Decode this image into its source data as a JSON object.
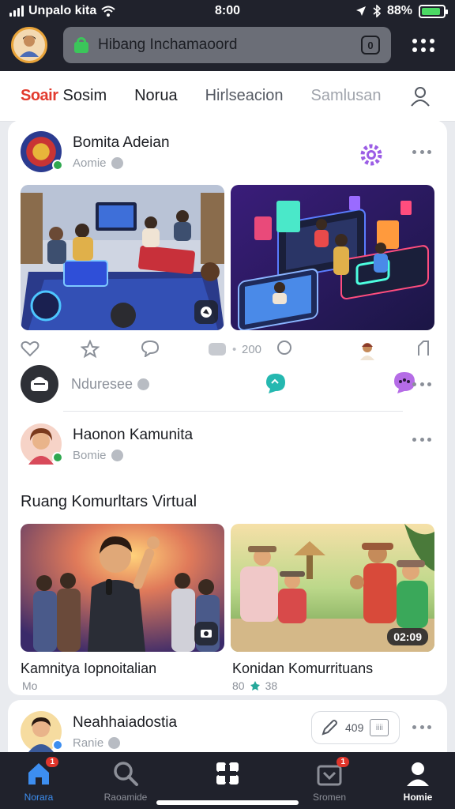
{
  "status_bar": {
    "carrier": "Unpalo kita",
    "time": "8:00",
    "battery": "88%",
    "battery_level": 0.88
  },
  "header": {
    "url_text": "Hibang  Inchamaoord",
    "tab_count": "0"
  },
  "tabs": [
    {
      "label": "Soair",
      "style": "logo"
    },
    {
      "label": "Sosim"
    },
    {
      "label": "Norua"
    },
    {
      "label": "Hirlseacion"
    },
    {
      "label": "Samlusan"
    }
  ],
  "post1": {
    "author": "Bomita Adeian",
    "sub": "Aomie",
    "engagement_count": "200",
    "reply_label": "Nduresee"
  },
  "post2": {
    "author": "Haonon Kamunita",
    "sub": "Bomie",
    "section_title": "Ruang Komurltars Virtual",
    "media": [
      {
        "caption": "Kamnitya Iopnoitalian",
        "sub": "Mo"
      },
      {
        "caption": "Konidan Komurrituans",
        "sub": "80",
        "sub2": "38",
        "duration": "02:09"
      }
    ]
  },
  "post3": {
    "author": "Neahhaiadostia",
    "sub": "Ranie",
    "stat_count": "409",
    "stat_box": "iiii"
  },
  "bottom_nav": [
    {
      "label": "Norara",
      "badge": "1"
    },
    {
      "label": "Raoamide"
    },
    {
      "label": ""
    },
    {
      "label": "Sromen",
      "badge": "1"
    },
    {
      "label": "Homie"
    }
  ],
  "colors": {
    "accent": "#3d8ef0",
    "brand_red": "#e23b2e",
    "header_bg": "#20222c",
    "verified": "#2fa84f"
  }
}
